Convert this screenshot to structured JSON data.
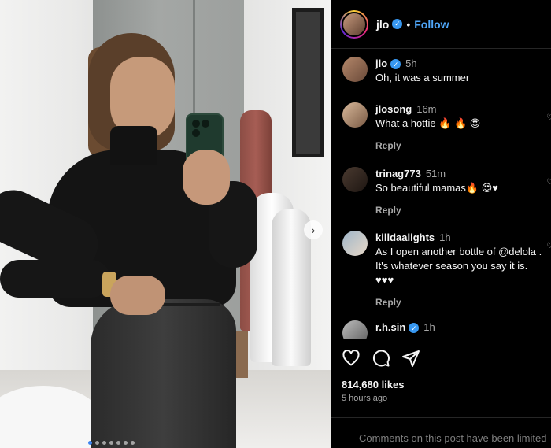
{
  "post": {
    "header": {
      "username": "jlo",
      "separator": "•",
      "follow_label": "Follow"
    },
    "comments": [
      {
        "username": "jlo",
        "time": "5h",
        "text": "Oh, it was a summer",
        "verified": true
      },
      {
        "username": "jlosong",
        "time": "16m",
        "text": "What a hottie 🔥 🔥 😍",
        "reply_label": "Reply"
      },
      {
        "username": "trinag773",
        "time": "51m",
        "text": "So beautiful mamas🔥 😍♥",
        "reply_label": "Reply"
      },
      {
        "username": "killdaalights",
        "time": "1h",
        "text": "As I open another bottle of @delola . It's whatever season you say it is. ♥♥♥",
        "reply_label": "Reply"
      },
      {
        "username": "r.h.sin",
        "time": "1h",
        "verified": true
      }
    ],
    "likes": "814,680 likes",
    "posted_ago": "5 hours ago",
    "comments_limited_text": "Comments on this post have been limited"
  },
  "icons": [
    "heart-icon",
    "comment-icon",
    "share-icon",
    "verified-icon",
    "carousel-next-icon"
  ],
  "colors": {
    "accent": "#4fa6f8",
    "verified": "#3797f0",
    "background": "#000000",
    "muted_text": "#a8a8a8"
  }
}
